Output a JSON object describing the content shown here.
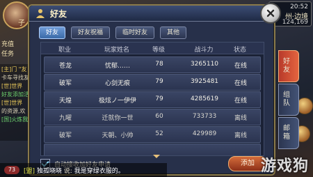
{
  "hud": {
    "player_name": "子",
    "left_labels": [
      "充值",
      "任务"
    ],
    "left_chat": [
      {
        "text": "[主]门 \"友",
        "cls": "y"
      },
      {
        "text": "卡车寻找友",
        "cls": ""
      },
      {
        "text": "[世]世界",
        "cls": "y"
      },
      {
        "text": "好友添加活",
        "cls": "g"
      },
      {
        "text": "[世]世界",
        "cls": "y"
      },
      {
        "text": "的资源,欢",
        "cls": ""
      },
      {
        "text": "[国]火炼我",
        "cls": "g"
      }
    ],
    "time": "20:52",
    "location": "州·边境",
    "coords": "124,169"
  },
  "dialog": {
    "title": "好友",
    "tabs": [
      "好友",
      "好友祝福",
      "临时好友",
      "其他"
    ],
    "active_tab": 0,
    "headers": {
      "job": "职业",
      "name": "玩家姓名",
      "level": "等级",
      "power": "战斗力",
      "status": "状态"
    },
    "rows": [
      {
        "job": "苍龙",
        "name": "忧郁……",
        "level": "78",
        "power": "3265110",
        "status": "在线",
        "online": true
      },
      {
        "job": "破军",
        "name": "心剑无痕",
        "level": "79",
        "power": "3925481",
        "status": "在线",
        "online": true
      },
      {
        "job": "天煌",
        "name": "极炫ノ一伊伊",
        "level": "79",
        "power": "4285619",
        "status": "在线",
        "online": true
      },
      {
        "job": "九曜",
        "name": "迁就你一世",
        "level": "60",
        "power": "733733",
        "status": "离线",
        "online": false
      },
      {
        "job": "破军",
        "name": "天朝、小帅",
        "level": "52",
        "power": "429989",
        "status": "离线",
        "online": false
      },
      {
        "job": "",
        "name": "",
        "level": "",
        "power": "",
        "status": "",
        "online": false
      }
    ],
    "side_tabs": [
      "好友",
      "组队",
      "邮箱"
    ],
    "active_side_tab": 0,
    "auto_accept_label": "自动接收加好友申请",
    "auto_accept_checked": true,
    "action_button": "添加"
  },
  "chat_bar": {
    "badge": "73",
    "channel": "[盟]",
    "sender": "独孤晓晓",
    "verb": "说:",
    "message": "我是穿绿衣服的。"
  },
  "watermark": "游戏狗"
}
